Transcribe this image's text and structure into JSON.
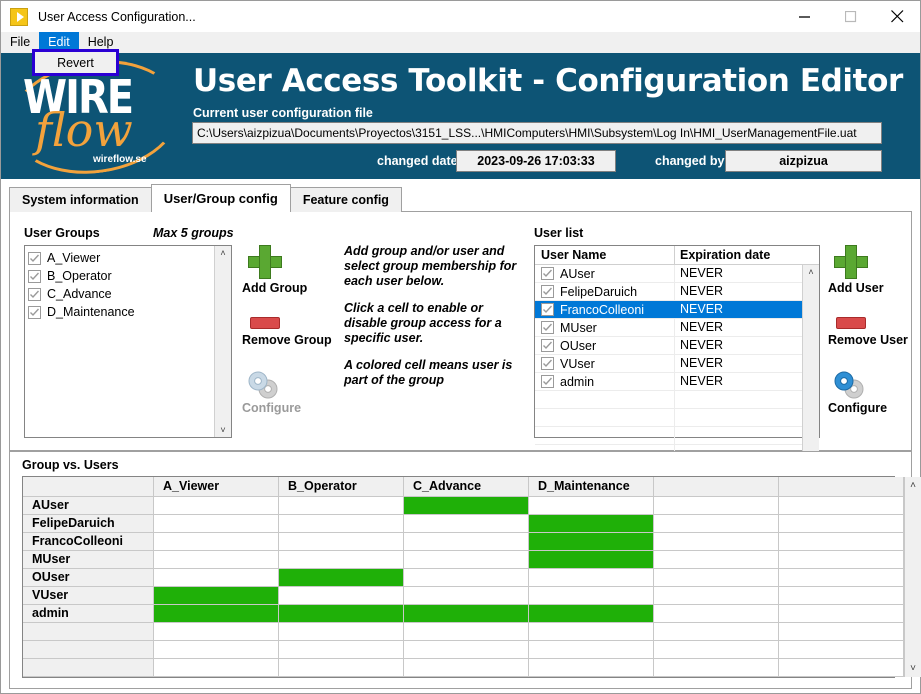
{
  "window": {
    "title": "User Access Configuration...",
    "icon": "app-play-icon",
    "minimize": "minimize-icon",
    "maximize": "maximize-icon",
    "close": "close-icon"
  },
  "menubar": {
    "items": [
      {
        "label": "File",
        "active": false
      },
      {
        "label": "Edit",
        "active": true
      },
      {
        "label": "Help",
        "active": false
      }
    ],
    "open_menu": {
      "parent": "Edit",
      "items": [
        {
          "label": "Revert"
        }
      ]
    }
  },
  "banner": {
    "logo": {
      "word1": "WIRE",
      "word2": "flow",
      "site": "wireflow.se"
    },
    "title": "User Access Toolkit - Configuration Editor",
    "file_label": "Current user configuration file",
    "file_path": "C:\\Users\\aizpizua\\Documents\\Proyectos\\3151_LSS...\\HMIComputers\\HMI\\Subsystem\\Log In\\HMI_UserManagementFile.uat",
    "changed_date_label": "changed date",
    "changed_date_value": "2023-09-26 17:03:33",
    "changed_by_label": "changed by",
    "changed_by_value": "aizpizua",
    "bg_color": "#0d5475",
    "accent_color": "#f2a23c"
  },
  "tabs": [
    {
      "label": "System information",
      "active": false
    },
    {
      "label": "User/Group config",
      "active": true
    },
    {
      "label": "Feature config",
      "active": false
    }
  ],
  "user_groups": {
    "label": "User Groups",
    "max_note": "Max 5 groups",
    "items": [
      {
        "name": "A_Viewer",
        "checked": true
      },
      {
        "name": "B_Operator",
        "checked": true
      },
      {
        "name": "C_Advance",
        "checked": true
      },
      {
        "name": "D_Maintenance",
        "checked": true
      }
    ]
  },
  "group_buttons": {
    "add": {
      "label": "Add Group",
      "icon": "plus-icon",
      "enabled": true
    },
    "remove": {
      "label": "Remove Group",
      "icon": "minus-icon",
      "enabled": true
    },
    "configure": {
      "label": "Configure",
      "icon": "gear-icon",
      "enabled": false
    }
  },
  "help_text": {
    "p1": "Add group and/or user and select group membership for each user below.",
    "p2": "Click a cell to enable or disable group access for a specific user.",
    "p3": "A colored cell means user is part of the group"
  },
  "user_list": {
    "label": "User list",
    "columns": [
      "User Name",
      "Expiration date"
    ],
    "rows": [
      {
        "name": "AUser",
        "expiration": "NEVER",
        "checked": true,
        "selected": false
      },
      {
        "name": "FelipeDaruich",
        "expiration": "NEVER",
        "checked": true,
        "selected": false
      },
      {
        "name": "FrancoColleoni",
        "expiration": "NEVER",
        "checked": true,
        "selected": true
      },
      {
        "name": "MUser",
        "expiration": "NEVER",
        "checked": true,
        "selected": false
      },
      {
        "name": "OUser",
        "expiration": "NEVER",
        "checked": true,
        "selected": false
      },
      {
        "name": "VUser",
        "expiration": "NEVER",
        "checked": true,
        "selected": false
      },
      {
        "name": "admin",
        "expiration": "NEVER",
        "checked": true,
        "selected": false
      }
    ],
    "empty_rows": 4,
    "selection_color": "#0078d7"
  },
  "user_buttons": {
    "add": {
      "label": "Add User",
      "icon": "plus-icon",
      "enabled": true
    },
    "remove": {
      "label": "Remove User",
      "icon": "minus-icon",
      "enabled": true
    },
    "configure": {
      "label": "Configure",
      "icon": "gear-icon",
      "enabled": true
    }
  },
  "matrix": {
    "title": "Group vs. Users",
    "columns": [
      "A_Viewer",
      "B_Operator",
      "C_Advance",
      "D_Maintenance",
      "",
      ""
    ],
    "on_color": "#1fb008",
    "rows": [
      {
        "user": "AUser",
        "membership": [
          false,
          false,
          true,
          false,
          false,
          false
        ]
      },
      {
        "user": "FelipeDaruich",
        "membership": [
          false,
          false,
          false,
          true,
          false,
          false
        ]
      },
      {
        "user": "FrancoColleoni",
        "membership": [
          false,
          false,
          false,
          true,
          false,
          false
        ]
      },
      {
        "user": "MUser",
        "membership": [
          false,
          false,
          false,
          true,
          false,
          false
        ]
      },
      {
        "user": "OUser",
        "membership": [
          false,
          true,
          false,
          false,
          false,
          false
        ]
      },
      {
        "user": "VUser",
        "membership": [
          true,
          false,
          false,
          false,
          false,
          false
        ]
      },
      {
        "user": "admin",
        "membership": [
          true,
          true,
          true,
          true,
          false,
          false
        ]
      },
      {
        "user": "",
        "membership": [
          false,
          false,
          false,
          false,
          false,
          false
        ]
      },
      {
        "user": "",
        "membership": [
          false,
          false,
          false,
          false,
          false,
          false
        ]
      },
      {
        "user": "",
        "membership": [
          false,
          false,
          false,
          false,
          false,
          false
        ]
      }
    ]
  },
  "icons": {
    "scroll_up": "˄",
    "scroll_down": "˅"
  }
}
